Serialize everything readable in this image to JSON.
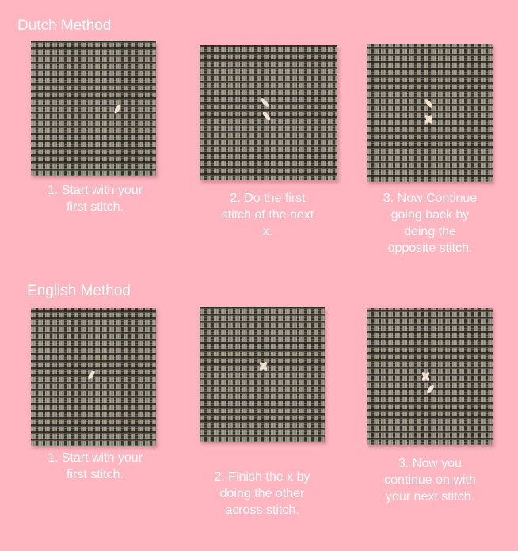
{
  "dutch": {
    "title": "Dutch Method",
    "steps": [
      {
        "caption": "1. Start with your\nfirst stitch."
      },
      {
        "caption": "2. Do the first\nstitch of the next\nx."
      },
      {
        "caption": "3. Now Continue\ngoing back by\ndoing the\nopposite stitch."
      }
    ]
  },
  "english": {
    "title": "English Method",
    "steps": [
      {
        "caption": "1. Start with your\nfirst stitch."
      },
      {
        "caption": "2. Finish the x by\ndoing the other\nacross stitch."
      },
      {
        "caption": "3. Now you\ncontinue on with\nyour next stitch."
      }
    ]
  }
}
